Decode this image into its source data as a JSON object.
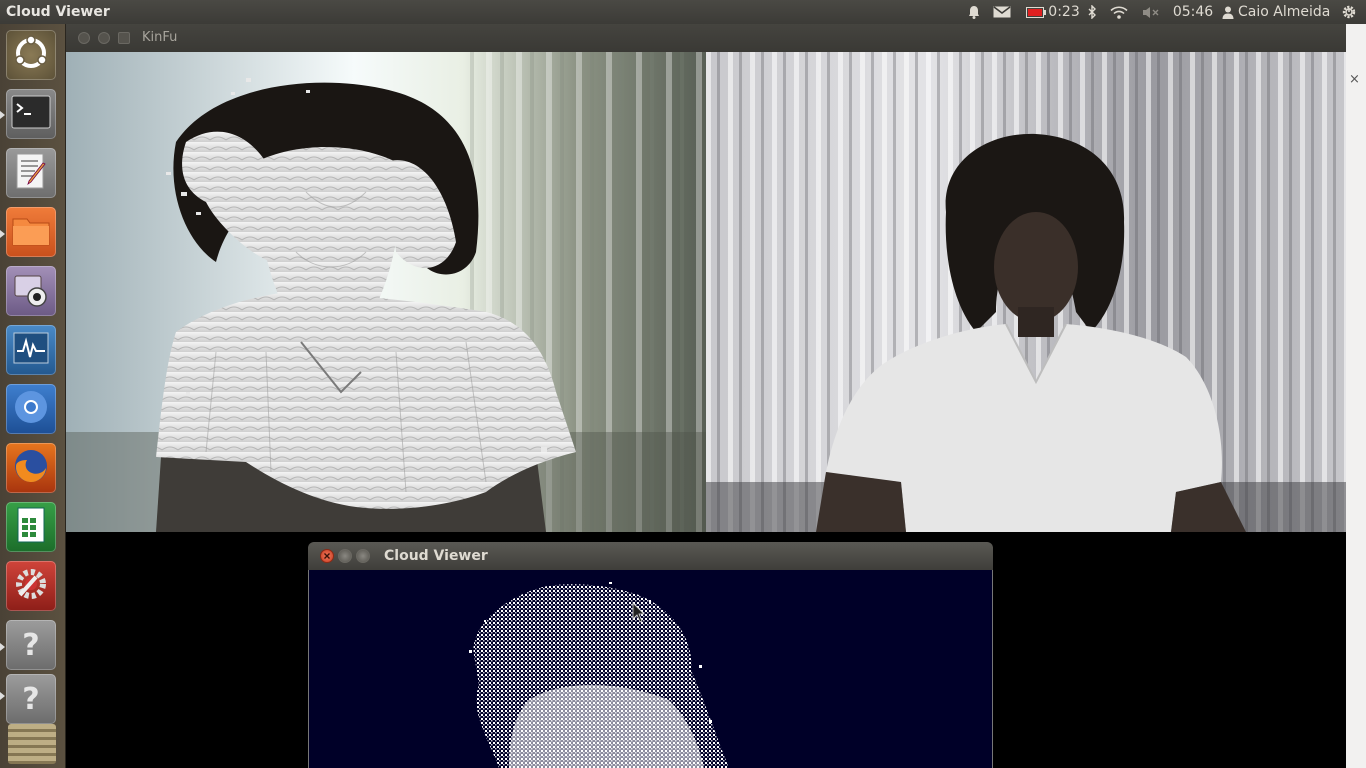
{
  "top_panel": {
    "app_title": "Cloud Viewer",
    "battery_time": "0:23",
    "clock": "05:46",
    "user_name": "Caio Almeida",
    "icons": [
      "bell-icon",
      "mail-icon",
      "battery-icon",
      "bluetooth-icon",
      "wifi-icon",
      "volume-muted-icon",
      "user-icon",
      "power-gear-icon"
    ]
  },
  "launcher": {
    "items": [
      {
        "name": "dash-home",
        "icon": "ubuntu-logo-icon"
      },
      {
        "name": "terminal",
        "icon": "terminal-icon"
      },
      {
        "name": "text-editor",
        "icon": "text-editor-icon"
      },
      {
        "name": "files",
        "icon": "folder-icon"
      },
      {
        "name": "webcam-app",
        "icon": "webcam-icon"
      },
      {
        "name": "system-monitor",
        "icon": "system-monitor-icon"
      },
      {
        "name": "chromium",
        "icon": "chromium-icon"
      },
      {
        "name": "firefox",
        "icon": "firefox-icon"
      },
      {
        "name": "spreadsheet",
        "icon": "spreadsheet-icon"
      },
      {
        "name": "system-settings",
        "icon": "settings-icon"
      },
      {
        "name": "unknown-app-1",
        "icon": "question-icon"
      },
      {
        "name": "unknown-app-2",
        "icon": "question-icon"
      }
    ]
  },
  "kinfu_window": {
    "title": "KinFu"
  },
  "cloud_viewer_window": {
    "title": "Cloud Viewer"
  },
  "colors": {
    "panel": "#3c3b37",
    "launcher": "#514837",
    "close": "#e2573a",
    "cloud_bg": "#000028"
  }
}
